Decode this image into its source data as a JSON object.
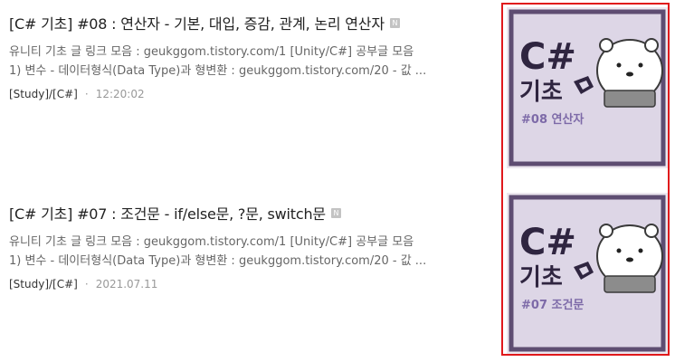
{
  "posts": [
    {
      "title": "[C# 기초] #08 : 연산자 - 기본, 대입, 증감, 관계, 논리 연산자",
      "badge": "N",
      "excerpt_line1": "유니티 기초 글 링크 모음 : geukggom.tistory.com/1 [Unity/C#] 공부글 모음",
      "excerpt_line2": "1) 변수 - 데이터형식(Data Type)과 형변환 : geukggom.tistory.com/20 - 값 ...",
      "category": "[Study]/[C#]",
      "separator": "·",
      "time": "12:20:02",
      "thumbnail": {
        "logo": "C#",
        "word": "기초",
        "caption": "#08 연산자",
        "icon": "unity-logo-icon",
        "mascot": "polar-bear-icon"
      }
    },
    {
      "title": "[C# 기초] #07 : 조건문 - if/else문, ?문, switch문",
      "badge": "N",
      "excerpt_line1": "유니티 기초 글 링크 모음 : geukggom.tistory.com/1 [Unity/C#] 공부글 모음",
      "excerpt_line2": "1) 변수 - 데이터형식(Data Type)과 형변환 : geukggom.tistory.com/20 - 값 ...",
      "category": "[Study]/[C#]",
      "separator": "·",
      "time": "2021.07.11",
      "thumbnail": {
        "logo": "C#",
        "word": "기초",
        "caption": "#07 조건문",
        "icon": "unity-logo-icon",
        "mascot": "polar-bear-icon"
      }
    }
  ],
  "colors": {
    "highlight_border": "#e0191c",
    "thumb_bg": "#ece7ef",
    "thumb_frame": "#5e4d72",
    "accent_purple": "#7d6aa8"
  }
}
